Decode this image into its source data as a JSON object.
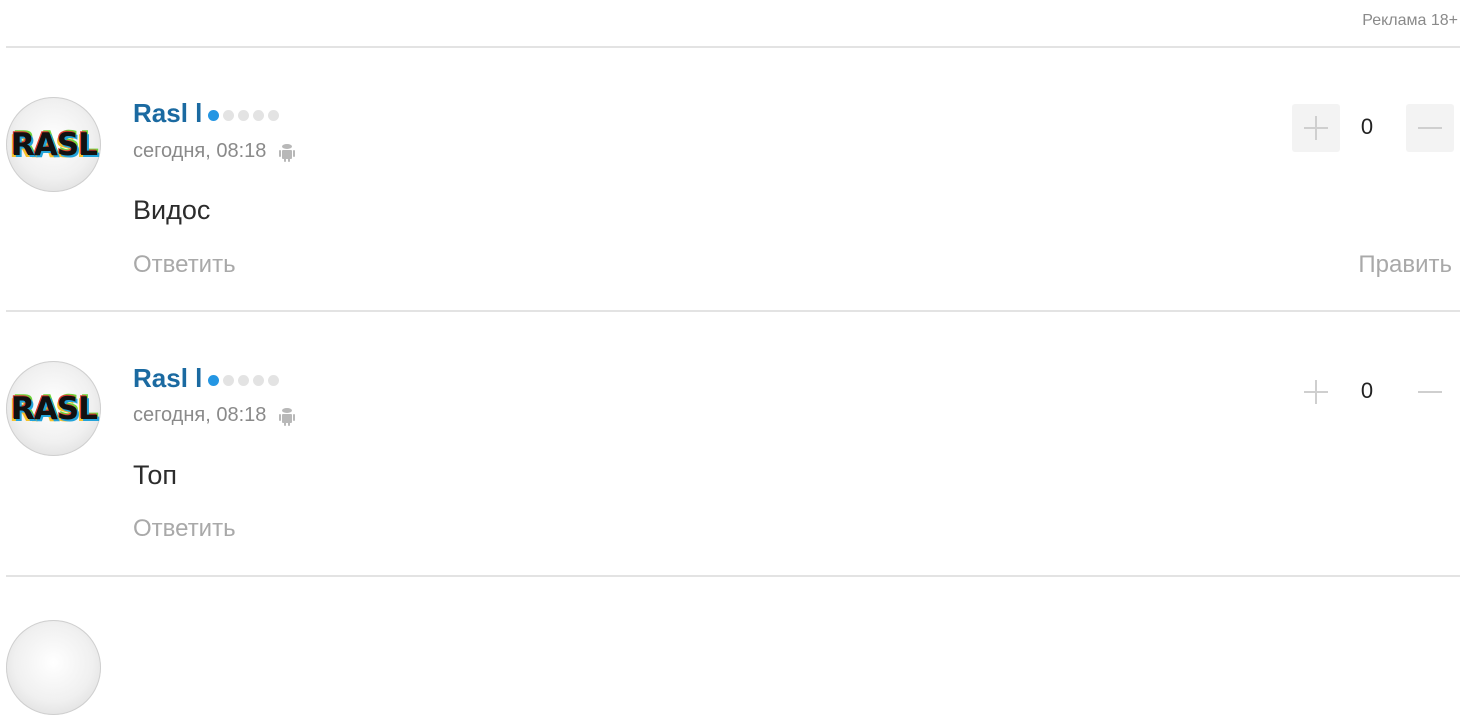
{
  "ad_label": "Реклама 18+",
  "comments": [
    {
      "avatar_text": "RASL",
      "author": "Rasl l",
      "rank_dots_total": 5,
      "rank_dots_filled": 1,
      "date": "сегодня, 08:18",
      "device_icon": "android-icon",
      "text": "Видос",
      "reply_label": "Ответить",
      "edit_label": "Править",
      "votes": "0",
      "upvote_icon": "plus-icon",
      "downvote_icon": "minus-icon"
    },
    {
      "avatar_text": "RASL",
      "author": "Rasl l",
      "rank_dots_total": 5,
      "rank_dots_filled": 1,
      "date": "сегодня, 08:18",
      "device_icon": "android-icon",
      "text": "Топ",
      "reply_label": "Ответить",
      "votes": "0",
      "upvote_icon": "plus-icon",
      "downvote_icon": "minus-icon"
    }
  ],
  "colors": {
    "author": "#1b6aa1",
    "rank_active": "#2496e3",
    "rank_inactive": "#e3e3e3",
    "muted": "#a9a9a9",
    "divider": "#e3e3e3"
  }
}
